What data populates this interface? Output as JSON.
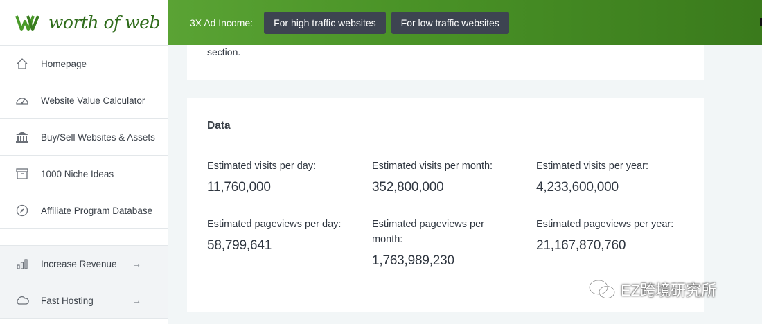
{
  "brand": {
    "name": "worth of web"
  },
  "sidebar": {
    "items": [
      {
        "label": "Homepage",
        "icon": "home-icon"
      },
      {
        "label": "Website Value Calculator",
        "icon": "gauge-icon"
      },
      {
        "label": "Buy/Sell Websites & Assets",
        "icon": "bank-icon"
      },
      {
        "label": "1000 Niche Ideas",
        "icon": "archive-icon"
      },
      {
        "label": "Affiliate Program Database",
        "icon": "compass-icon"
      }
    ],
    "secondary": [
      {
        "label": "Increase Revenue",
        "icon": "bar-chart-icon",
        "arrow": "→"
      },
      {
        "label": "Fast Hosting",
        "icon": "cloud-icon",
        "arrow": "→"
      }
    ]
  },
  "topbar": {
    "title": "3X Ad Income:",
    "buttons": [
      "For high traffic websites",
      "For low traffic websites"
    ]
  },
  "content": {
    "fragment": "section.",
    "data_title": "Data",
    "stats": [
      {
        "label": "Estimated visits per day:",
        "value": "11,760,000"
      },
      {
        "label": "Estimated visits per month:",
        "value": "352,800,000"
      },
      {
        "label": "Estimated visits per year:",
        "value": "4,233,600,000"
      },
      {
        "label": "Estimated pageviews per day:",
        "value": "58,799,641"
      },
      {
        "label": "Estimated pageviews per month:",
        "value": "1,763,989,230"
      },
      {
        "label": "Estimated pageviews per year:",
        "value": "21,167,870,760"
      }
    ]
  },
  "watermark": {
    "text": "EZ跨境研究所"
  },
  "colors": {
    "brand_green": "#4a9327",
    "button_dark": "#3d4451",
    "logo_green": "#2e6b1a"
  }
}
